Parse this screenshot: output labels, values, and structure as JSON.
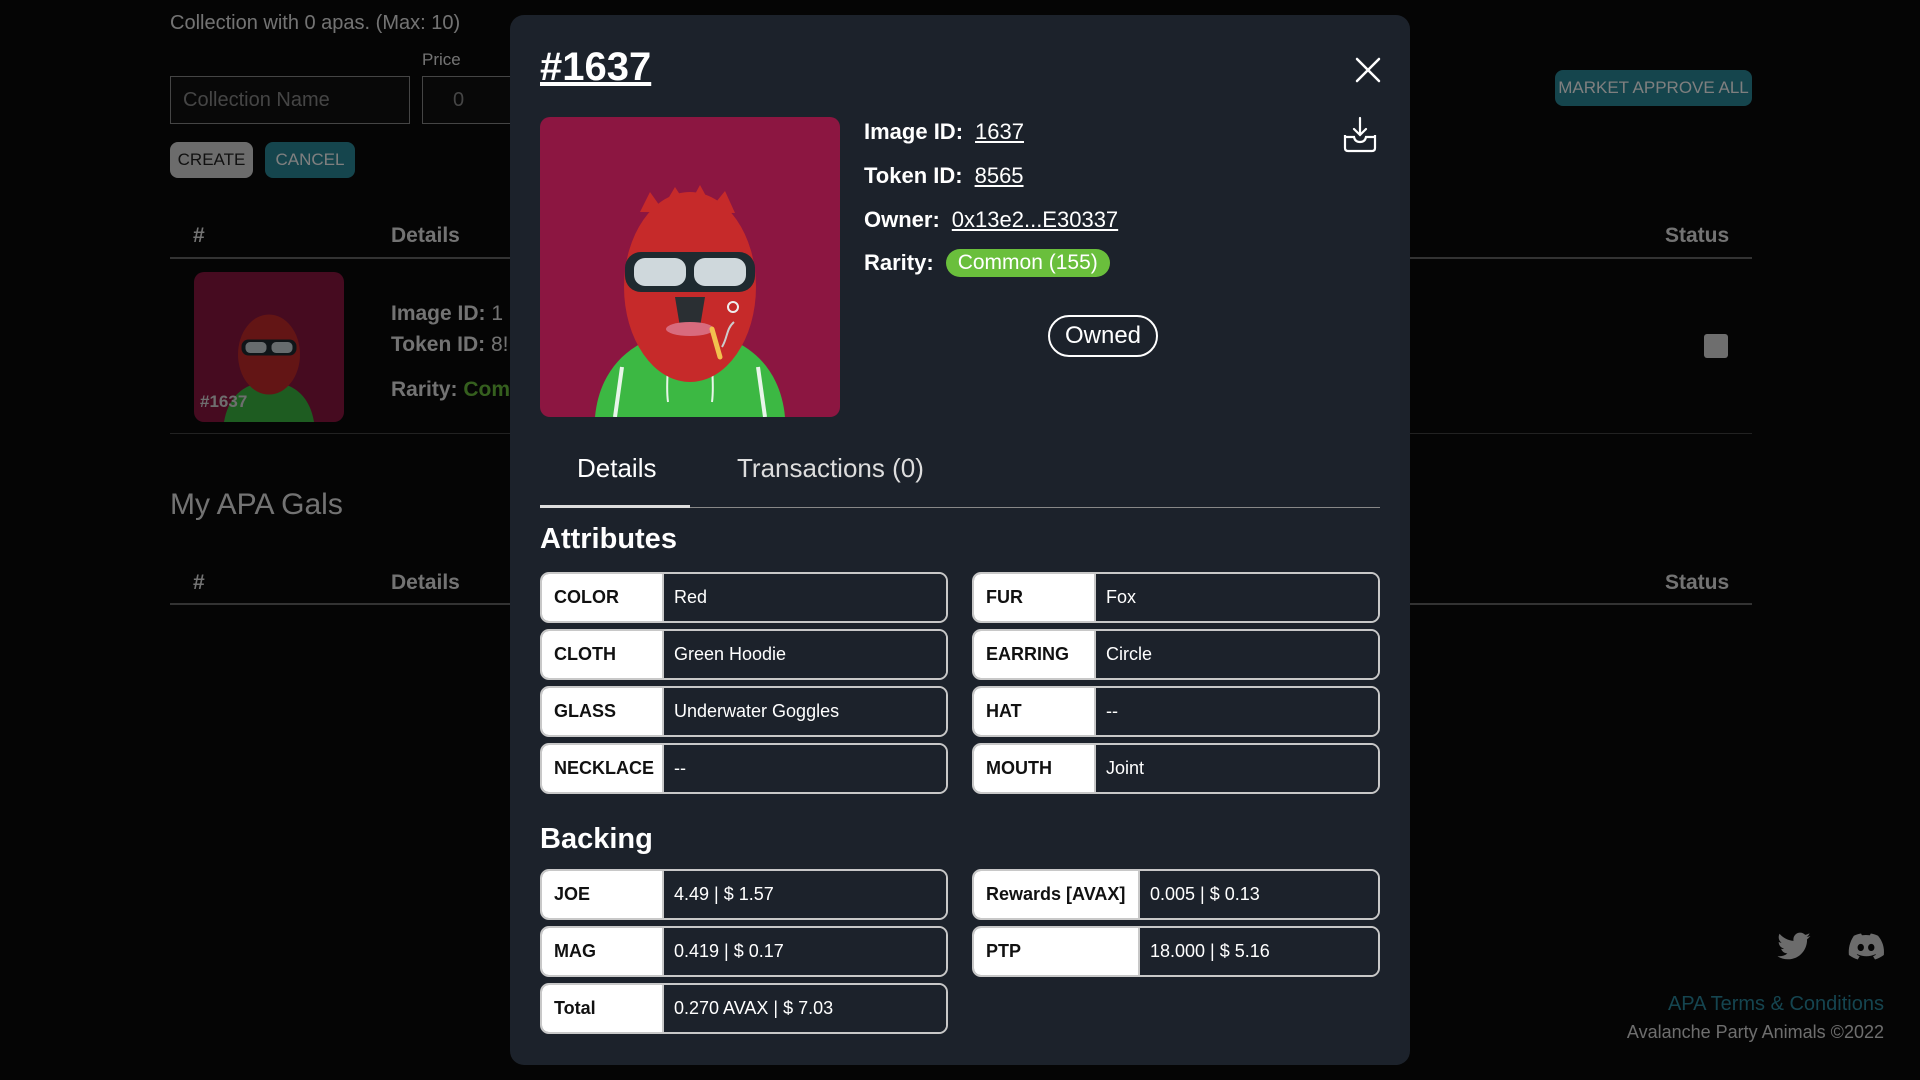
{
  "background": {
    "collection_info": "Collection with 0 apas. (Max: 10)",
    "price_label": "Price",
    "collection_name_placeholder": "Collection Name",
    "price_placeholder": "0",
    "create_label": "CREATE",
    "cancel_label": "CANCEL",
    "market_approve_all_label": "MARKET APPROVE ALL",
    "table_headers": {
      "hash": "#",
      "details": "Details",
      "status": "Status"
    },
    "row": {
      "thumb_label": "#1637",
      "image_id_label": "Image ID:",
      "image_id_value": "1",
      "token_id_label": "Token ID:",
      "token_id_value": "8!",
      "rarity_label": "Rarity:",
      "rarity_value": "Com"
    },
    "gals_title": "My APA Gals",
    "gals_headers": {
      "hash": "#",
      "details": "Details",
      "status": "Status"
    }
  },
  "modal": {
    "title": "#1637",
    "image_id_label": "Image ID:",
    "image_id": "1637",
    "token_id_label": "Token ID:",
    "token_id": "8565",
    "owner_label": "Owner:",
    "owner": "0x13e2...E30337",
    "rarity_label": "Rarity:",
    "rarity": "Common (155)",
    "owned_label": "Owned",
    "tabs": [
      {
        "label": "Details",
        "active": true
      },
      {
        "label": "Transactions (0)",
        "active": false
      }
    ],
    "attributes_title": "Attributes",
    "attributes": [
      {
        "key": "COLOR",
        "value": "Red"
      },
      {
        "key": "FUR",
        "value": "Fox"
      },
      {
        "key": "CLOTH",
        "value": "Green Hoodie"
      },
      {
        "key": "EARRING",
        "value": "Circle"
      },
      {
        "key": "GLASS",
        "value": "Underwater Goggles"
      },
      {
        "key": "HAT",
        "value": "--"
      },
      {
        "key": "NECKLACE",
        "value": "--"
      },
      {
        "key": "MOUTH",
        "value": "Joint"
      }
    ],
    "backing_title": "Backing",
    "backing": [
      {
        "key": "JOE",
        "value": "4.49 | $ 1.57"
      },
      {
        "key": "Rewards [AVAX]",
        "value": "0.005 | $ 0.13"
      },
      {
        "key": "MAG",
        "value": "0.419 | $ 0.17"
      },
      {
        "key": "PTP",
        "value": "18.000 | $ 5.16"
      },
      {
        "key": "Total",
        "value": "0.270 AVAX | $ 7.03"
      }
    ]
  },
  "footer": {
    "terms_link": "APA Terms & Conditions",
    "copyright": "Avalanche Party Animals ©2022"
  },
  "colors": {
    "accent_teal": "#2a8a9a",
    "rarity_common": "#6abf3c",
    "nft_background": "#8c1641",
    "modal_background": "#1c222b"
  }
}
